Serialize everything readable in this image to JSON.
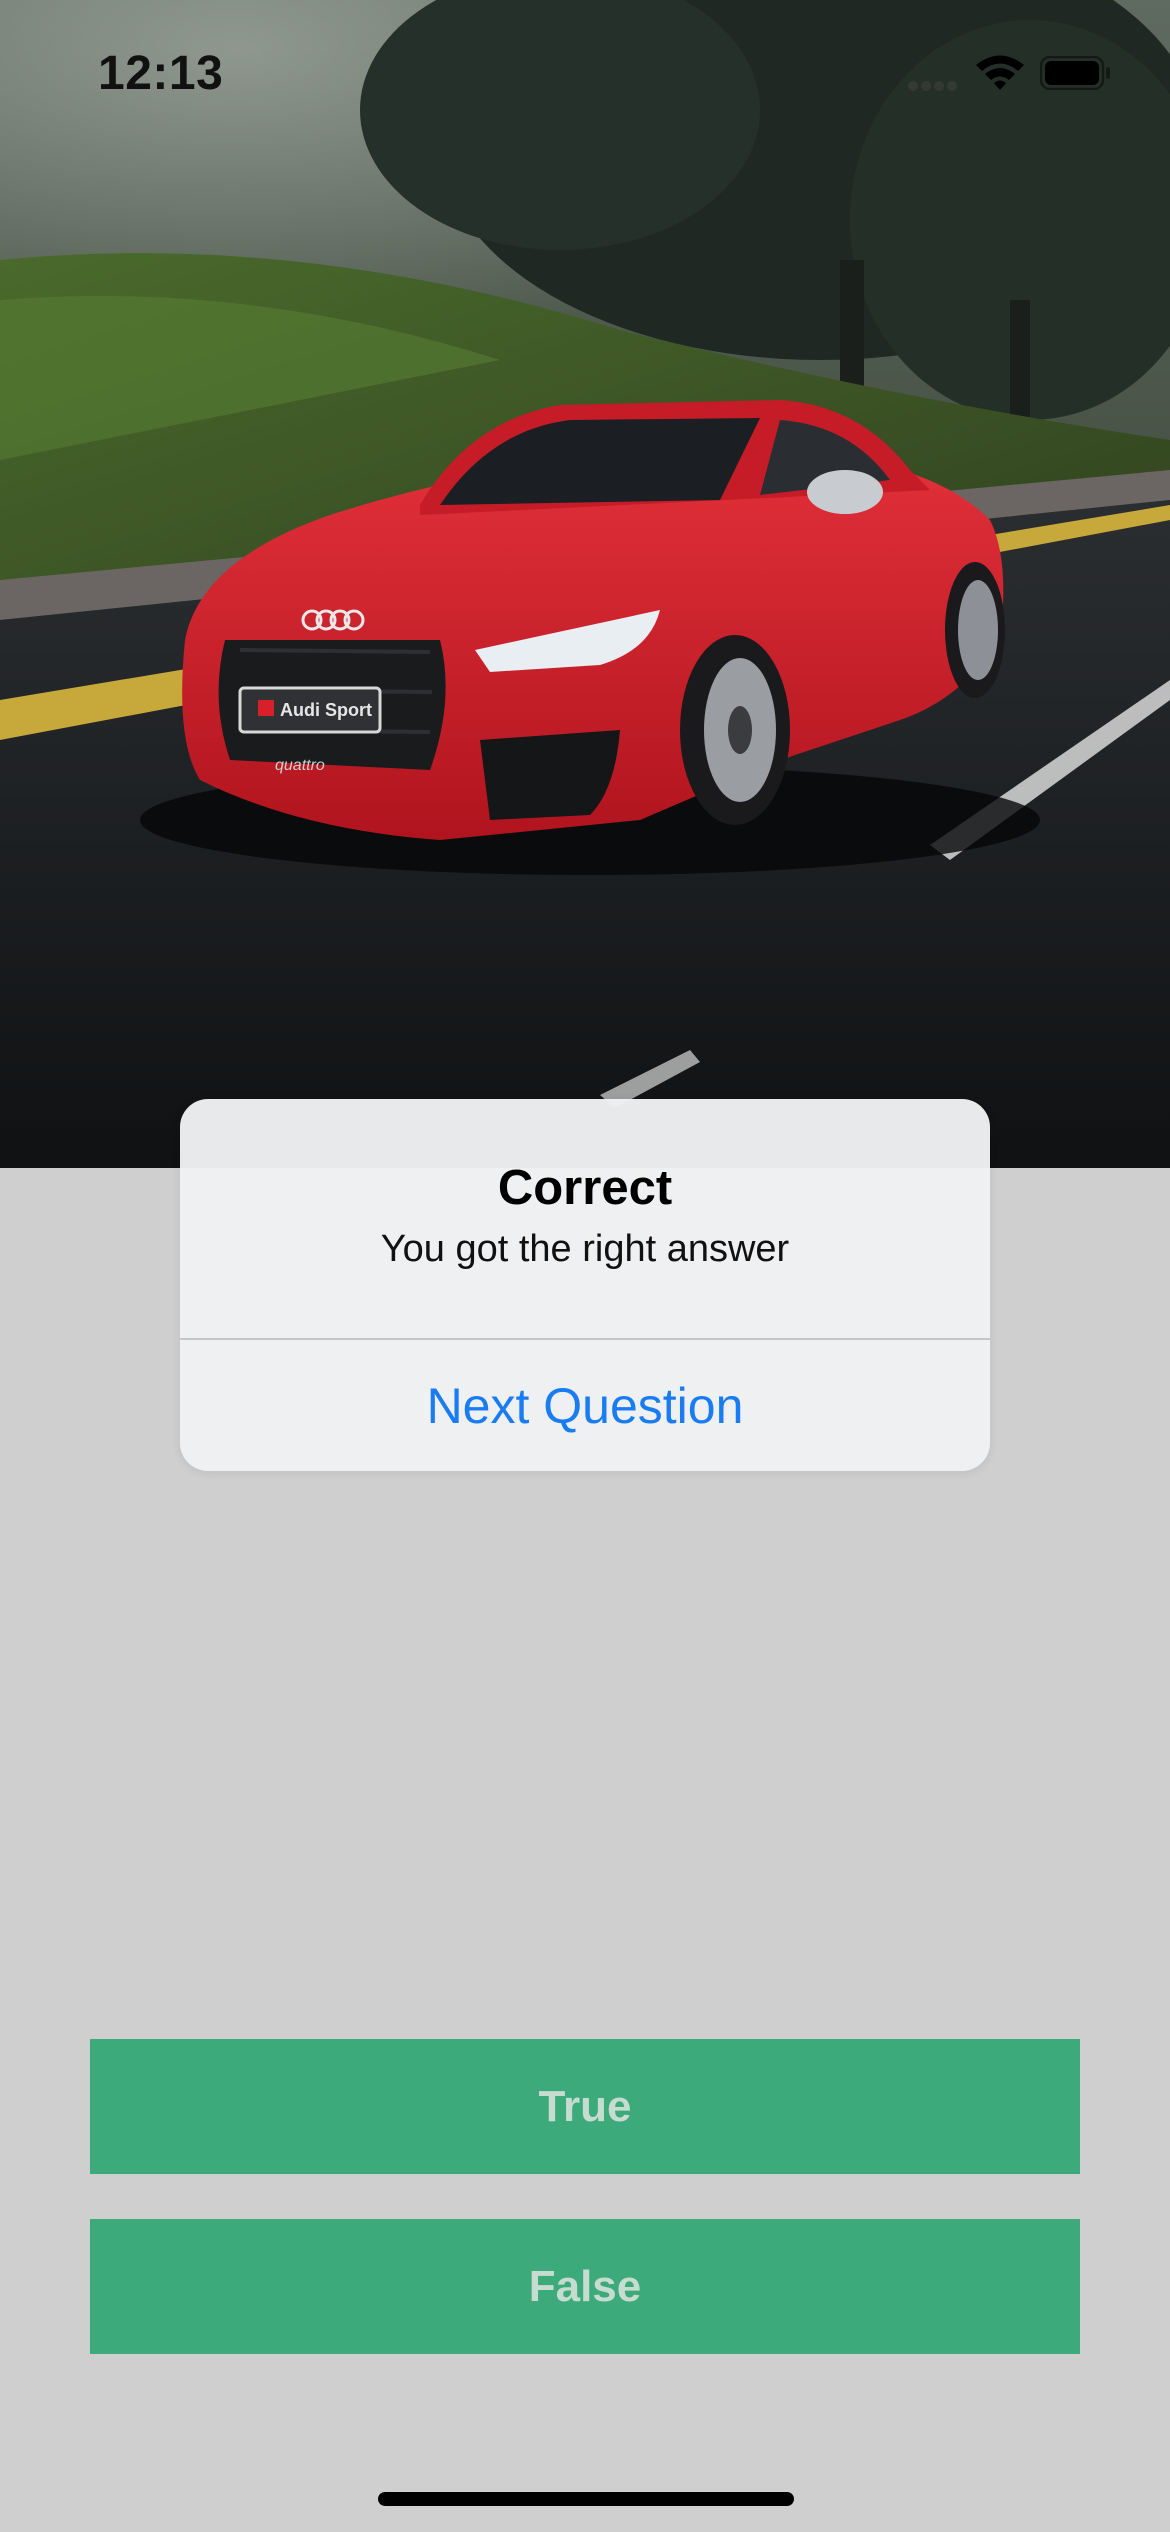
{
  "status_bar": {
    "time": "12:13",
    "wifi_icon": "wifi-icon",
    "battery_icon": "battery-full-icon",
    "cellular_icon": "cellular-signal-icon"
  },
  "hero_image": {
    "subject": "red sports car on road",
    "plate_text": "Audi Sport",
    "badge_text": "quattro",
    "body_color": "#d8202a"
  },
  "alert": {
    "title": "Correct",
    "message": "You got the right answer",
    "action_label": "Next Question",
    "action_color": "#1a7cf2"
  },
  "answers": {
    "true_label": "True",
    "false_label": "False",
    "button_color": "#3caa7b"
  }
}
